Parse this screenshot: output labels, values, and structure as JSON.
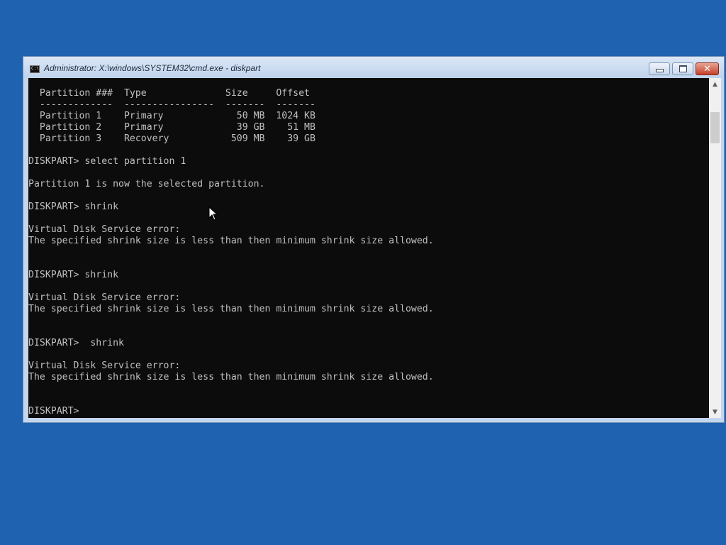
{
  "window": {
    "title": "Administrator: X:\\windows\\SYSTEM32\\cmd.exe - diskpart",
    "app_icon_text": "C:\\.",
    "icon": "cmd-icon",
    "buttons": {
      "minimize": "minimize-icon",
      "maximize": "maximize-icon",
      "close": "✕"
    }
  },
  "console": {
    "lines": [
      "  Partition ###  Type              Size     Offset",
      "  -------------  ----------------  -------  -------",
      "  Partition 1    Primary             50 MB  1024 KB",
      "  Partition 2    Primary             39 GB    51 MB",
      "  Partition 3    Recovery           509 MB    39 GB",
      "",
      "DISKPART> select partition 1",
      "",
      "Partition 1 is now the selected partition.",
      "",
      "DISKPART> shrink",
      "",
      "Virtual Disk Service error:",
      "The specified shrink size is less than then minimum shrink size allowed.",
      "",
      "",
      "DISKPART> shrink",
      "",
      "Virtual Disk Service error:",
      "The specified shrink size is less than then minimum shrink size allowed.",
      "",
      "",
      "DISKPART>  shrink",
      "",
      "Virtual Disk Service error:",
      "The specified shrink size is less than then minimum shrink size allowed.",
      "",
      "",
      "DISKPART> "
    ]
  },
  "scrollbar": {
    "up": "▲",
    "down": "▼"
  },
  "colors": {
    "desktop": "#1f62b0",
    "console_bg": "#0c0c0c",
    "console_text": "#c0c0c0"
  }
}
